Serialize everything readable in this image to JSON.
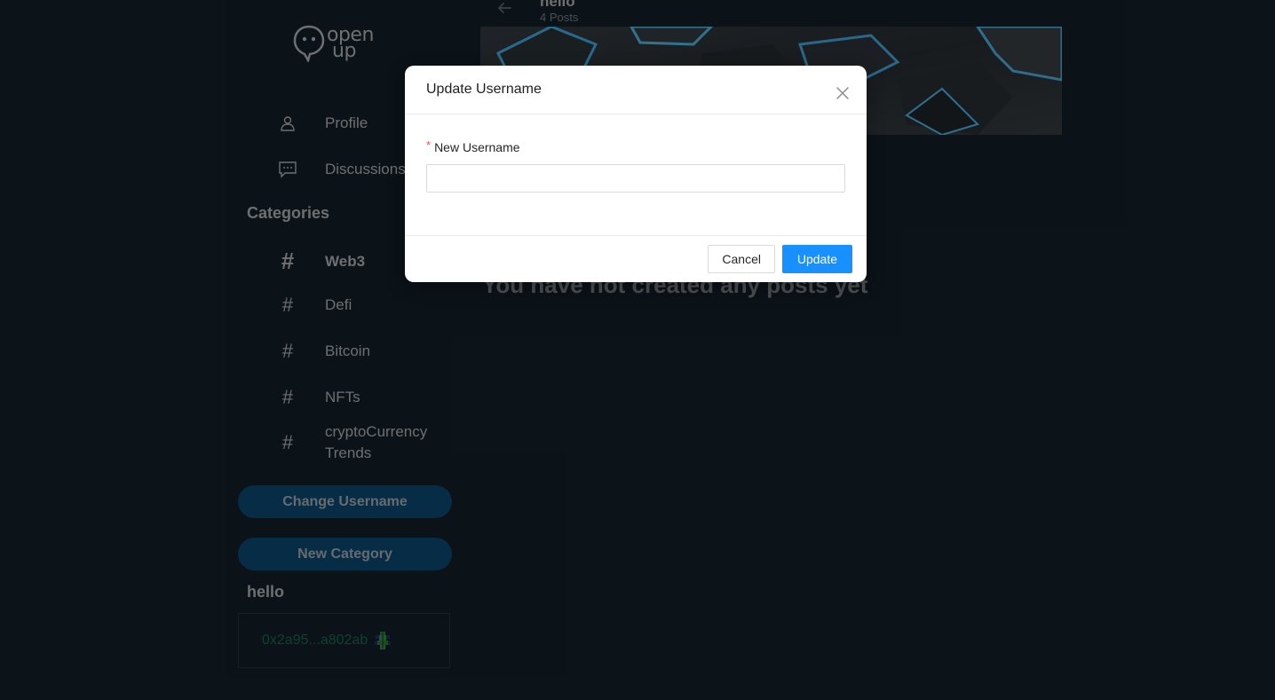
{
  "brand": {
    "logo_line1": "open",
    "logo_line2": "up"
  },
  "sidebar": {
    "nav": [
      {
        "label": "Profile",
        "icon": "user-icon"
      },
      {
        "label": "Discussions",
        "icon": "chat-icon"
      }
    ],
    "categories_heading": "Categories",
    "categories": [
      {
        "label": "Web3",
        "active": true
      },
      {
        "label": "Defi"
      },
      {
        "label": "Bitcoin"
      },
      {
        "label": "NFTs"
      },
      {
        "label": "cryptoCurrency Trends"
      }
    ],
    "change_username_label": "Change Username",
    "new_category_label": "New Category",
    "user_name": "hello",
    "wallet_address": "0x2a95...a802ab"
  },
  "main": {
    "profile_name": "hello",
    "post_count": "4 Posts",
    "empty_message": "You have not created any posts yet"
  },
  "modal": {
    "title": "Update Username",
    "field_required_mark": "*",
    "field_label": "New Username",
    "field_value": "",
    "cancel_label": "Cancel",
    "update_label": "Update"
  },
  "colors": {
    "background": "#15222d",
    "sidebar_button": "#0e517f",
    "wallet_text": "#137a55",
    "primary": "#1890ff",
    "required": "#ff4d4f"
  }
}
